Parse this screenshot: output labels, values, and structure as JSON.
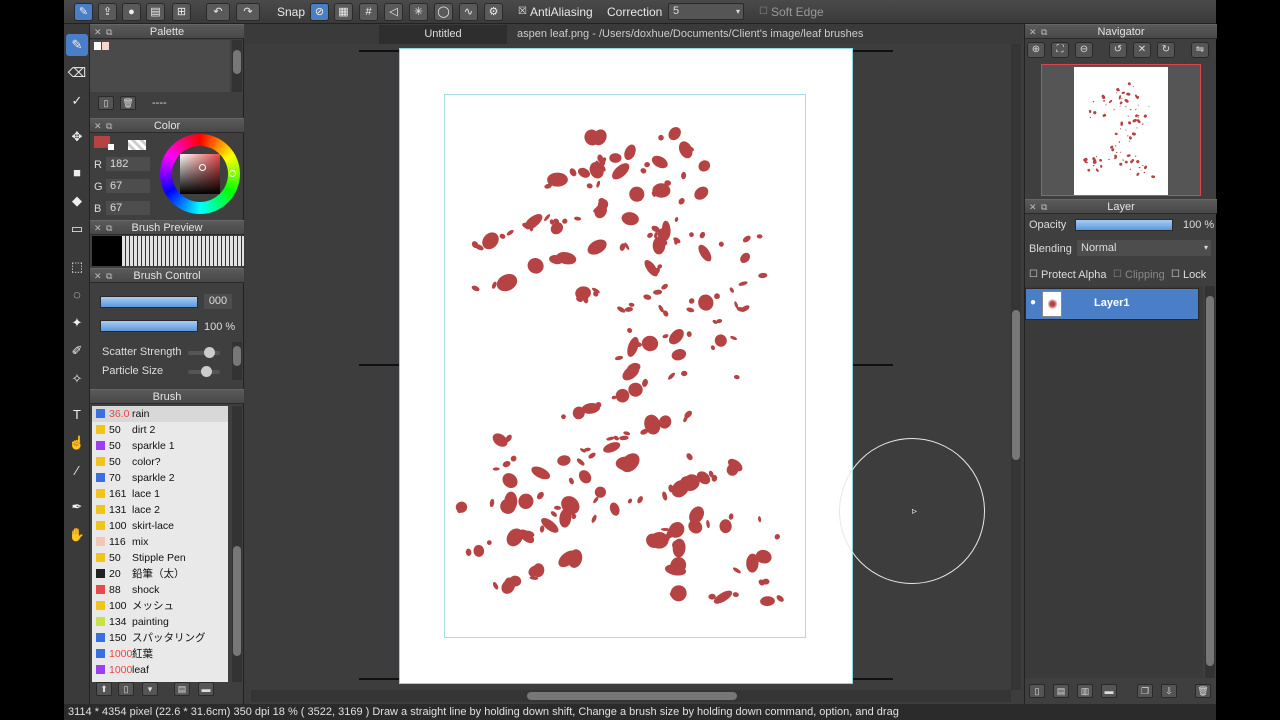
{
  "toolbar": {
    "snap_label": "Snap",
    "antialiasing_label": "AntiAliasing",
    "antialiasing_checked": true,
    "correction_label": "Correction",
    "correction_value": "5",
    "soft_edge_label": "Soft Edge",
    "soft_edge_checked": false
  },
  "palette": {
    "title": "Palette",
    "placeholder": "----"
  },
  "color": {
    "title": "Color",
    "r_label": "R",
    "r_value": "182",
    "g_label": "G",
    "g_value": "67",
    "b_label": "B",
    "b_value": "67",
    "current_hex": "#b64343"
  },
  "brush_preview": {
    "title": "Brush Preview"
  },
  "brush_control": {
    "title": "Brush Control",
    "size_value": "000",
    "opacity_value": "100 %",
    "scatter_label": "Scatter Strength",
    "scatter_level": 0.7,
    "particle_label": "Particle Size",
    "particle_level": 0.6
  },
  "brush": {
    "title": "Brush",
    "items": [
      {
        "size": "36.0",
        "name": "rain",
        "color": "#3a6fe0",
        "red": true,
        "selected": true
      },
      {
        "size": "50",
        "name": "dirt 2",
        "color": "#f0c419",
        "red": false
      },
      {
        "size": "50",
        "name": "sparkle 1",
        "color": "#9b3ff0",
        "red": false
      },
      {
        "size": "50",
        "name": "color?",
        "color": "#f0c419",
        "red": false
      },
      {
        "size": "70",
        "name": "sparkle 2",
        "color": "#3a6fe0",
        "red": false
      },
      {
        "size": "161",
        "name": "lace 1",
        "color": "#f0c419",
        "red": false
      },
      {
        "size": "131",
        "name": "lace 2",
        "color": "#f0c419",
        "red": false
      },
      {
        "size": "100",
        "name": "skirt-lace",
        "color": "#f0c419",
        "red": false
      },
      {
        "size": "116",
        "name": "mix",
        "color": "#f2c7b8",
        "red": false
      },
      {
        "size": "50",
        "name": "Stipple Pen",
        "color": "#f0c419",
        "red": false
      },
      {
        "size": "20",
        "name": "鉛筆（太）",
        "color": "#222222",
        "red": false
      },
      {
        "size": "88",
        "name": "shock",
        "color": "#e84a4a",
        "red": false
      },
      {
        "size": "100",
        "name": "メッシュ",
        "color": "#f0c419",
        "red": false
      },
      {
        "size": "134",
        "name": "painting",
        "color": "#c8e04a",
        "red": false
      },
      {
        "size": "150",
        "name": "スパッタリング",
        "color": "#3a6fe0",
        "red": false
      },
      {
        "size": "1000",
        "name": "紅葉",
        "color": "#3a6fe0",
        "red": true
      },
      {
        "size": "1000",
        "name": "leaf",
        "color": "#9b3ff0",
        "red": true
      }
    ]
  },
  "tabs": [
    {
      "label": "Untitled"
    },
    {
      "label": "aspen leaf.png - /Users/doxhue/Documents/Client's image/leaf brushes"
    }
  ],
  "navigator": {
    "title": "Navigator"
  },
  "layer": {
    "title": "Layer",
    "opacity_label": "Opacity",
    "opacity_value": "100 %",
    "opacity_level": 1.0,
    "blending_label": "Blending",
    "blending_value": "Normal",
    "protect_alpha_label": "Protect Alpha",
    "clipping_label": "Clipping",
    "lock_label": "Lock",
    "layers": [
      {
        "name": "Layer1"
      }
    ]
  },
  "status": {
    "text": "3114 * 4354 pixel   (22.6 * 31.6cm)   350 dpi   18 %   ( 3522, 3169 )   Draw a straight line by holding down shift, Change a brush size by holding down command, option, and drag"
  },
  "icons": [
    "brush-icon",
    "eraser-icon",
    "select-pen-icon",
    "move-icon",
    "fill-rect-icon",
    "bucket-icon",
    "gradation-icon",
    "rect-select-icon",
    "lasso-icon",
    "magic-wand-icon",
    "select-pen-icon",
    "select-eraser-icon",
    "text-icon",
    "operation-icon",
    "eyedropper-icon",
    "dropper-icon",
    "hand-icon"
  ],
  "colors": {
    "leaf": "#b64343",
    "accent": "#4a7fc8"
  }
}
